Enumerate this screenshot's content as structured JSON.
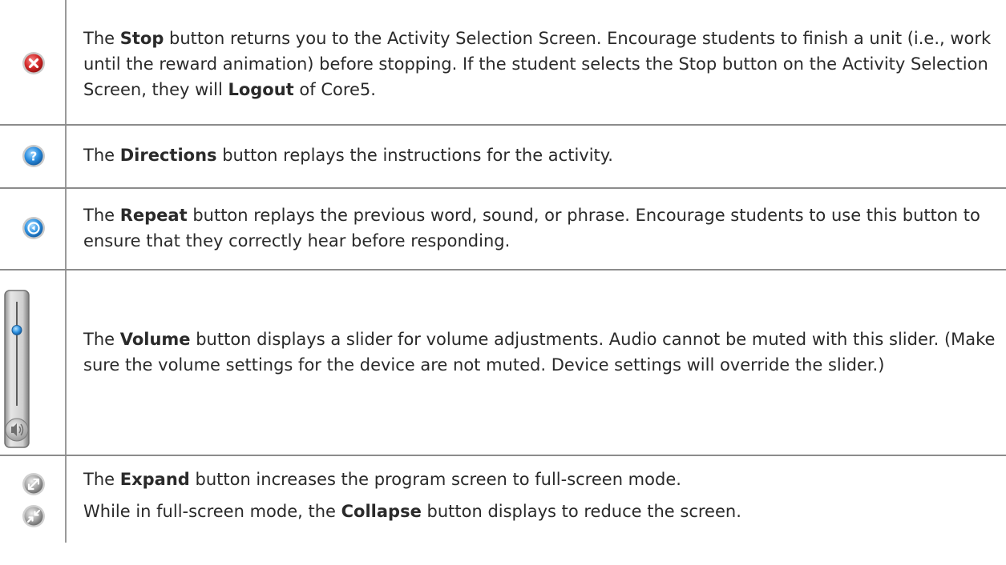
{
  "rows": [
    {
      "icon": "stop-icon",
      "segments": [
        {
          "t": "The ",
          "b": false
        },
        {
          "t": "Stop",
          "b": true
        },
        {
          "t": " button returns you to the Activity Selection Screen. Encourage students to finish a unit (i.e., work until the reward animation) before stopping. If the student selects the Stop button on the Activity Selection Screen, they will ",
          "b": false
        },
        {
          "t": "Logout",
          "b": true
        },
        {
          "t": " of Core5.",
          "b": false
        }
      ]
    },
    {
      "icon": "question-icon",
      "segments": [
        {
          "t": "The ",
          "b": false
        },
        {
          "t": "Directions",
          "b": true
        },
        {
          "t": " button replays the instructions for the activity.",
          "b": false
        }
      ]
    },
    {
      "icon": "repeat-icon",
      "segments": [
        {
          "t": "The ",
          "b": false
        },
        {
          "t": "Repeat",
          "b": true
        },
        {
          "t": " button replays the previous word, sound, or phrase. Encourage students to use this button to ensure that they correctly hear before responding.",
          "b": false
        }
      ]
    },
    {
      "icon": "volume-slider-icon",
      "volume_level": 0.75,
      "segments": [
        {
          "t": "The ",
          "b": false
        },
        {
          "t": "Volume",
          "b": true
        },
        {
          "t": " button displays a slider for volume adjustments. Audio cannot be muted with this slider. (Make sure the volume settings for the device are not muted. Device settings will override the slider.)",
          "b": false
        }
      ]
    },
    {
      "icon": "expand-icon",
      "segments": [
        {
          "t": "The ",
          "b": false
        },
        {
          "t": "Expand",
          "b": true
        },
        {
          "t": " button increases the program screen to full-screen mode.",
          "b": false
        }
      ]
    },
    {
      "icon": "collapse-icon",
      "segments": [
        {
          "t": "While in full-screen mode, the ",
          "b": false
        },
        {
          "t": "Collapse",
          "b": true
        },
        {
          "t": " button displays to reduce the screen.",
          "b": false
        }
      ]
    }
  ]
}
